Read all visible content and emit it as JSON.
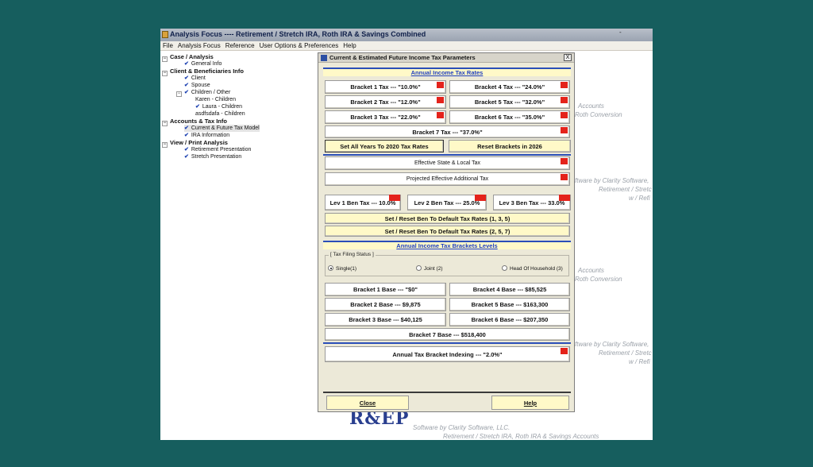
{
  "app": {
    "title": "Analysis Focus ---- Retirement / Stretch IRA, Roth IRA & Savings Combined",
    "minimize": "-",
    "menu": [
      "File",
      "Analysis Focus",
      "Reference",
      "User Options & Preferences",
      "Help"
    ]
  },
  "tree": {
    "case_analysis": "Case / Analysis",
    "general_info": "General Info",
    "client_beneficiaries": "Client & Beneficiaries Info",
    "client": "Client",
    "spouse": "Spouse",
    "children_other": "Children / Other",
    "karen": "Karen - Children",
    "laura": "Laura - Children",
    "asdfsdafa": "asdfsdafa - Children",
    "accounts_tax": "Accounts & Tax Info",
    "current_future_tax": "Current & Future Tax Model",
    "ira_information": "IRA Information",
    "view_print": "View / Print Analysis",
    "retirement_presentation": "Retirement Presentation",
    "stretch_presentation": "Stretch Presentation"
  },
  "background": {
    "accounts_1": "Accounts",
    "roth_conversion_1": "Roth Conversion",
    "software_by_1": "ftware by Clarity Software,",
    "retirement_stretch_1": "Retirement / Stretc",
    "w_refi_1": "w / Refi",
    "accounts_2": "Accounts",
    "roth_conversion_2": "Roth Conversion",
    "software_by_2": "ftware by Clarity Software,",
    "retirement_stretch_2": "Retirement / Stretc",
    "w_refi_2": "w / Refi",
    "logo_text": "R&EP",
    "software_footer": "Software by Clarity Software, LLC.",
    "tagline_footer": "Retirement / Stretch IRA, Roth IRA & Savings Accounts"
  },
  "dialog": {
    "title": "Current & Estimated Future Income Tax Parameters",
    "close_x": "X",
    "rates_header": "Annual Income Tax Rates",
    "bracket1_tax": "Bracket 1 Tax --- \"10.0%\"",
    "bracket2_tax": "Bracket 2 Tax --- \"12.0%\"",
    "bracket3_tax": "Bracket 3 Tax --- \"22.0%\"",
    "bracket4_tax": "Bracket 4 Tax --- \"24.0%\"",
    "bracket5_tax": "Bracket 5 Tax --- \"32.0%\"",
    "bracket6_tax": "Bracket 6 Tax --- \"35.0%\"",
    "bracket7_tax": "Bracket 7 Tax --- \"37.0%\"",
    "set_all_years": "Set All Years To 2020 Tax Rates",
    "reset_brackets": "Reset Brackets in 2026",
    "effective_state_local": "Effective State & Local Tax",
    "projected_additional": "Projected Effective Additional Tax",
    "lev1_ben": "Lev 1 Ben Tax --- 10.0%",
    "lev2_ben": "Lev 2 Ben Tax --- 25.0%",
    "lev3_ben": "Lev 3 Ben Tax --- 33.0%",
    "reset_ben_135": "Set / Reset Ben To Default Tax Rates (1, 3, 5)",
    "reset_ben_257": "Set / Reset Ben To Default Tax Rates (2, 5, 7)",
    "levels_header": "Annual Income Tax Brackets Levels",
    "filing_status_legend": "[ Tax Filing Status ]",
    "single": "Single(1)",
    "joint": "Joint (2)",
    "head_household": "Head Of Household (3)",
    "bracket1_base": "Bracket 1 Base --- \"$0\"",
    "bracket2_base": "Bracket 2 Base --- $9,875",
    "bracket3_base": "Bracket 3 Base --- $40,125",
    "bracket4_base": "Bracket 4 Base --- $85,525",
    "bracket5_base": "Bracket 5 Base --- $163,300",
    "bracket6_base": "Bracket 6 Base --- $207,350",
    "bracket7_base": "Bracket 7 Base --- $518,400",
    "indexing": "Annual Tax Bracket Indexing --- \"2.0%\"",
    "close": "Close",
    "help": "Help"
  },
  "colors": {
    "desktop": "#165e5e",
    "flag_red": "#e4231b",
    "section_blue": "#1f3fc0",
    "highlight_yellow": "#fff9c8"
  }
}
